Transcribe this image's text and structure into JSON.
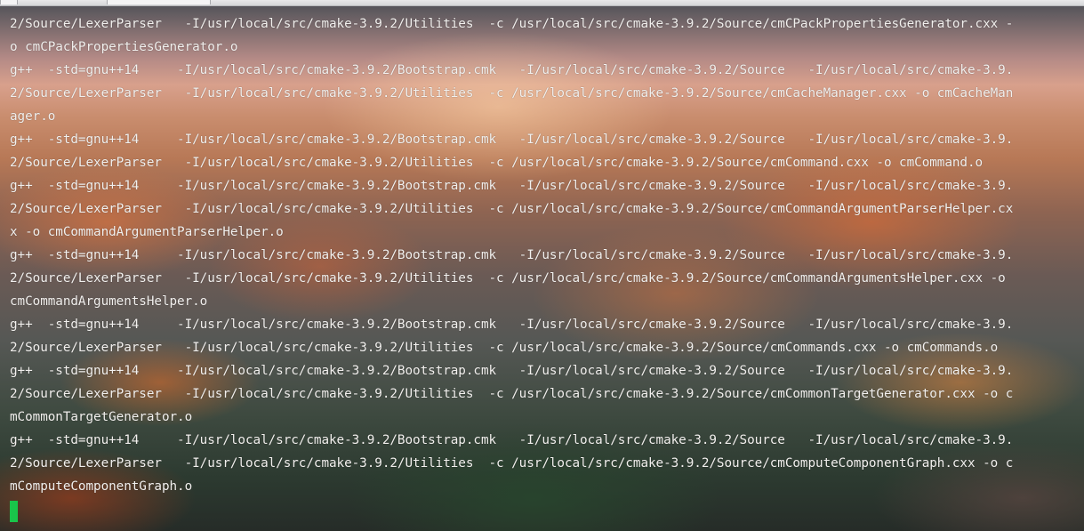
{
  "terminal": {
    "lines": [
      "2/Source/LexerParser   -I/usr/local/src/cmake-3.9.2/Utilities  -c /usr/local/src/cmake-3.9.2/Source/cmCPackPropertiesGenerator.cxx -",
      "o cmCPackPropertiesGenerator.o",
      "g++  -std=gnu++14     -I/usr/local/src/cmake-3.9.2/Bootstrap.cmk   -I/usr/local/src/cmake-3.9.2/Source   -I/usr/local/src/cmake-3.9.",
      "2/Source/LexerParser   -I/usr/local/src/cmake-3.9.2/Utilities  -c /usr/local/src/cmake-3.9.2/Source/cmCacheManager.cxx -o cmCacheMan",
      "ager.o",
      "g++  -std=gnu++14     -I/usr/local/src/cmake-3.9.2/Bootstrap.cmk   -I/usr/local/src/cmake-3.9.2/Source   -I/usr/local/src/cmake-3.9.",
      "2/Source/LexerParser   -I/usr/local/src/cmake-3.9.2/Utilities  -c /usr/local/src/cmake-3.9.2/Source/cmCommand.cxx -o cmCommand.o",
      "g++  -std=gnu++14     -I/usr/local/src/cmake-3.9.2/Bootstrap.cmk   -I/usr/local/src/cmake-3.9.2/Source   -I/usr/local/src/cmake-3.9.",
      "2/Source/LexerParser   -I/usr/local/src/cmake-3.9.2/Utilities  -c /usr/local/src/cmake-3.9.2/Source/cmCommandArgumentParserHelper.cx",
      "x -o cmCommandArgumentParserHelper.o",
      "g++  -std=gnu++14     -I/usr/local/src/cmake-3.9.2/Bootstrap.cmk   -I/usr/local/src/cmake-3.9.2/Source   -I/usr/local/src/cmake-3.9.",
      "2/Source/LexerParser   -I/usr/local/src/cmake-3.9.2/Utilities  -c /usr/local/src/cmake-3.9.2/Source/cmCommandArgumentsHelper.cxx -o",
      "cmCommandArgumentsHelper.o",
      "g++  -std=gnu++14     -I/usr/local/src/cmake-3.9.2/Bootstrap.cmk   -I/usr/local/src/cmake-3.9.2/Source   -I/usr/local/src/cmake-3.9.",
      "2/Source/LexerParser   -I/usr/local/src/cmake-3.9.2/Utilities  -c /usr/local/src/cmake-3.9.2/Source/cmCommands.cxx -o cmCommands.o",
      "g++  -std=gnu++14     -I/usr/local/src/cmake-3.9.2/Bootstrap.cmk   -I/usr/local/src/cmake-3.9.2/Source   -I/usr/local/src/cmake-3.9.",
      "2/Source/LexerParser   -I/usr/local/src/cmake-3.9.2/Utilities  -c /usr/local/src/cmake-3.9.2/Source/cmCommonTargetGenerator.cxx -o c",
      "mCommonTargetGenerator.o",
      "g++  -std=gnu++14     -I/usr/local/src/cmake-3.9.2/Bootstrap.cmk   -I/usr/local/src/cmake-3.9.2/Source   -I/usr/local/src/cmake-3.9.",
      "2/Source/LexerParser   -I/usr/local/src/cmake-3.9.2/Utilities  -c /usr/local/src/cmake-3.9.2/Source/cmComputeComponentGraph.cxx -o c",
      "mComputeComponentGraph.o"
    ],
    "text_color": "#f2f0ee",
    "cursor_color": "#19c44a",
    "cursor_icon": "block-cursor"
  }
}
